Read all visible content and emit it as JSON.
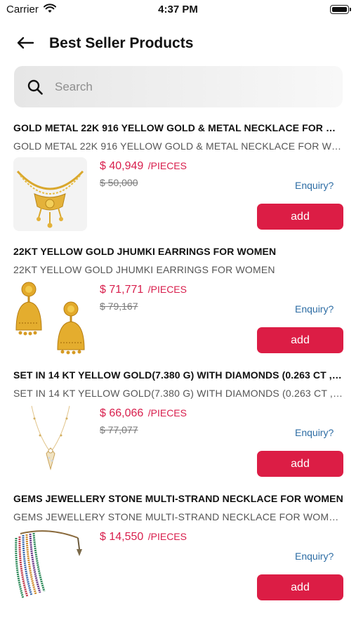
{
  "status_bar": {
    "carrier": "Carrier",
    "time": "4:37 PM"
  },
  "header": {
    "title": "Best Seller Products"
  },
  "search": {
    "placeholder": "Search"
  },
  "products": [
    {
      "title": "GOLD METAL 22K 916 YELLOW GOLD & METAL NECKLACE FOR WOM...",
      "subtitle": "GOLD METAL 22K 916 YELLOW GOLD & METAL NECKLACE FOR WOM...",
      "price": "$ 40,949",
      "unit": "/PIECES",
      "mrp": "$ 50,000",
      "enquiry": "Enquiry?",
      "add_label": "add",
      "image": "gold-necklace"
    },
    {
      "title": "22KT YELLOW GOLD JHUMKI EARRINGS FOR WOMEN",
      "subtitle": "22KT YELLOW GOLD JHUMKI EARRINGS FOR WOMEN",
      "price": "$ 71,771",
      "unit": "/PIECES",
      "mrp": "$ 79,167",
      "enquiry": "Enquiry?",
      "add_label": "add",
      "image": "jhumki-earrings"
    },
    {
      "title": "SET IN 14 KT YELLOW GOLD(7.380 G) WITH DIAMONDS (0.263 CT ,IJ...",
      "subtitle": "SET IN 14 KT YELLOW GOLD(7.380 G) WITH DIAMONDS (0.263 CT ,IJ-SI)",
      "price": "$ 66,066",
      "unit": "/PIECES",
      "mrp": "$ 77,077",
      "enquiry": "Enquiry?",
      "add_label": "add",
      "image": "diamond-pendant"
    },
    {
      "title": "GEMS JEWELLERY STONE MULTI-STRAND NECKLACE FOR WOMEN",
      "subtitle": "GEMS JEWELLERY STONE MULTI-STRAND NECKLACE FOR WOMEN (...",
      "price": "$ 14,550",
      "unit": "/PIECES",
      "enquiry": "Enquiry?",
      "add_label": "add",
      "image": "multistrand-necklace"
    }
  ],
  "colors": {
    "accent": "#dc1d45",
    "price": "#d81e4c",
    "link": "#2e6da4"
  }
}
